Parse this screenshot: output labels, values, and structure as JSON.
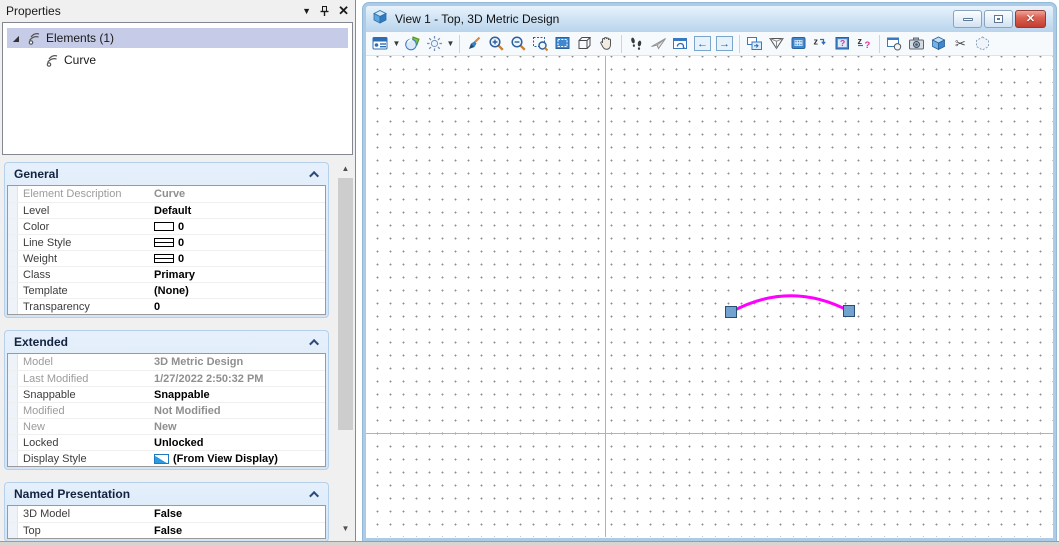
{
  "properties_panel": {
    "title": "Properties",
    "titlebar_icons": [
      "dropdown-icon",
      "pin-icon",
      "close-icon"
    ],
    "tree": {
      "root_label": "Elements (1)",
      "child_label": "Curve",
      "item_icon": "curve-element-icon"
    },
    "sections": {
      "general": {
        "title": "General",
        "rows": [
          {
            "label": "Element Description",
            "value": "Curve"
          },
          {
            "label": "Level",
            "value": "Default"
          },
          {
            "label": "Color",
            "value": "0",
            "swatch": "color-swatch"
          },
          {
            "label": "Line Style",
            "value": "0",
            "swatch": "line-style-swatch"
          },
          {
            "label": "Weight",
            "value": "0",
            "swatch": "weight-swatch"
          },
          {
            "label": "Class",
            "value": "Primary"
          },
          {
            "label": "Template",
            "value": "(None)"
          },
          {
            "label": "Transparency",
            "value": "0"
          }
        ]
      },
      "extended": {
        "title": "Extended",
        "rows": [
          {
            "label": "Model",
            "value": "3D Metric Design"
          },
          {
            "label": "Last Modified",
            "value": "1/27/2022 2:50:32 PM"
          },
          {
            "label": "Snappable",
            "value": "Snappable"
          },
          {
            "label": "Modified",
            "value": "Not Modified"
          },
          {
            "label": "New",
            "value": "New"
          },
          {
            "label": "Locked",
            "value": "Unlocked"
          },
          {
            "label": "Display Style",
            "value": "(From View Display)",
            "swatch": "display-style-swatch"
          }
        ]
      },
      "named_presentation": {
        "title": "Named Presentation",
        "rows": [
          {
            "label": "3D Model",
            "value": "False"
          },
          {
            "label": "Top",
            "value": "False"
          }
        ]
      }
    }
  },
  "view_window": {
    "title": "View 1 - Top, 3D Metric Design",
    "window_buttons": [
      "minimize",
      "restore",
      "close"
    ],
    "toolbar_icons": [
      "view-attributes",
      "display-style",
      "adjust-brightness",
      "update-view",
      "zoom-in",
      "zoom-out",
      "window-area",
      "fit-view",
      "rotate-view",
      "pan-view",
      "walk",
      "fly",
      "navigate-view",
      "view-previous",
      "view-next",
      "copy-view",
      "clip-volume",
      "clip-mask",
      "set-active-depth",
      "show-display-depth",
      "show-active-depth",
      "saved-view",
      "camera",
      "view-cube",
      "cut-clip-element",
      "paste-clip-element"
    ],
    "canvas": {
      "selected_element": "Curve",
      "curve_color": "#ff00ff",
      "handle_color": "#72a2cf",
      "grid": "dotted"
    }
  }
}
